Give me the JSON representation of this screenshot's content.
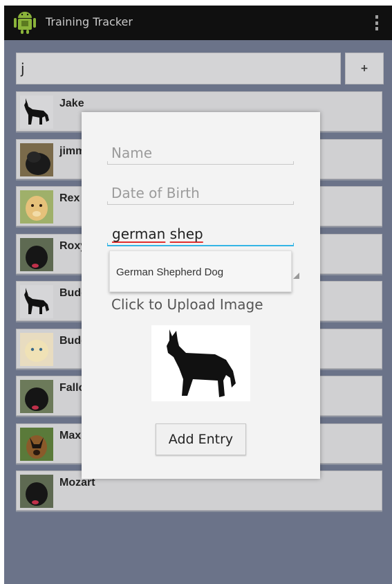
{
  "app": {
    "title": "Training Tracker",
    "icon": "android-icon"
  },
  "search": {
    "value": "j"
  },
  "toolbar": {
    "add_label": "+"
  },
  "list": {
    "items": [
      {
        "name": "Jake",
        "thumb": "shepherd-silhouette"
      },
      {
        "name": "jimmy",
        "thumb": "black-dog-photo"
      },
      {
        "name": "Rex",
        "thumb": "golden-retriever-photo"
      },
      {
        "name": "Roxy",
        "thumb": "black-dog-photo"
      },
      {
        "name": "Buddy",
        "thumb": "shepherd-silhouette"
      },
      {
        "name": "Buddy",
        "thumb": "yellow-puppy-photo"
      },
      {
        "name": "Fallon",
        "thumb": "black-dog-photo"
      },
      {
        "name": "Max",
        "thumb": "german-shepherd-photo"
      },
      {
        "name": "Mozart",
        "thumb": "black-dog-photo"
      }
    ]
  },
  "dialog": {
    "name_placeholder": "Name",
    "dob_placeholder": "Date of Birth",
    "breed_value_word1": "german",
    "breed_value_word2": "shep",
    "suggestion": "German Shepherd Dog",
    "upload_label": "Click to Upload Image",
    "preview_image": "shepherd-silhouette",
    "add_entry_label": "Add Entry"
  },
  "colors": {
    "action_bar": "#101010",
    "background": "#6b7389",
    "accent": "#33b5e5",
    "dialog": "#f3f3f3"
  }
}
